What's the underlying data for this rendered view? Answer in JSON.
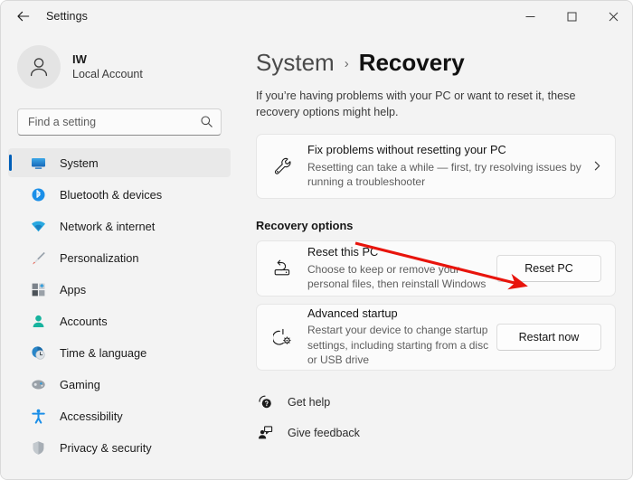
{
  "window": {
    "titlebar_title": "Settings",
    "back_icon": "back-arrow-icon",
    "minimize_label": "–",
    "maximize_label": "□",
    "close_label": "✕"
  },
  "sidebar": {
    "account": {
      "initials": "IW",
      "name": "IW",
      "type": "Local Account",
      "avatar_icon": "person-avatar-icon"
    },
    "search": {
      "placeholder": "Find a setting",
      "value": "",
      "icon": "search-icon"
    },
    "items": [
      {
        "label": "System",
        "icon": "system-monitor-icon",
        "selected": true
      },
      {
        "label": "Bluetooth & devices",
        "icon": "bluetooth-icon",
        "selected": false
      },
      {
        "label": "Network & internet",
        "icon": "wifi-icon",
        "selected": false
      },
      {
        "label": "Personalization",
        "icon": "paintbrush-icon",
        "selected": false
      },
      {
        "label": "Apps",
        "icon": "apps-grid-icon",
        "selected": false
      },
      {
        "label": "Accounts",
        "icon": "account-person-icon",
        "selected": false
      },
      {
        "label": "Time & language",
        "icon": "clock-globe-icon",
        "selected": false
      },
      {
        "label": "Gaming",
        "icon": "gamepad-icon",
        "selected": false
      },
      {
        "label": "Accessibility",
        "icon": "accessibility-icon",
        "selected": false
      },
      {
        "label": "Privacy & security",
        "icon": "shield-icon",
        "selected": false
      }
    ]
  },
  "main": {
    "breadcrumb": {
      "parent": "System",
      "separator": "›",
      "current": "Recovery"
    },
    "description": "If you’re having problems with your PC or want to reset it, these recovery options might help.",
    "fix_card": {
      "title": "Fix problems without resetting your PC",
      "subtitle": "Resetting can take a while — first, try resolving issues by running a troubleshooter",
      "icon": "wrench-icon",
      "chevron_icon": "chevron-right-icon"
    },
    "section_title": "Recovery options",
    "reset_card": {
      "title": "Reset this PC",
      "subtitle": "Choose to keep or remove your personal files, then reinstall Windows",
      "icon": "reset-pc-icon",
      "button_label": "Reset PC"
    },
    "advanced_card": {
      "title": "Advanced startup",
      "subtitle": "Restart your device to change startup settings, including starting from a disc or USB drive",
      "icon": "power-gear-icon",
      "button_label": "Restart now"
    },
    "footer_links": [
      {
        "label": "Get help",
        "icon": "help-question-icon"
      },
      {
        "label": "Give feedback",
        "icon": "feedback-person-icon"
      }
    ]
  },
  "annotation": {
    "arrow_color": "#e8140c",
    "arrow_description": "red-arrow-pointing-to-reset-pc-button"
  },
  "colors": {
    "accent": "#005fb8",
    "window_bg": "#f3f3f3",
    "card_bg": "#fbfbfb",
    "annotation_red": "#e8140c"
  }
}
